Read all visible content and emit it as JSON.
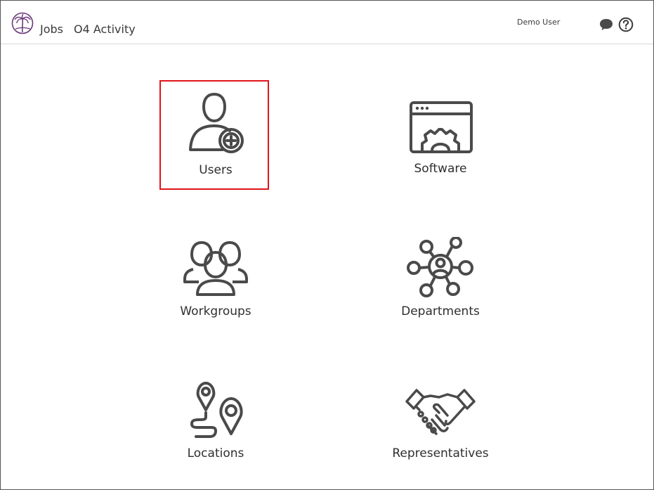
{
  "header": {
    "nav": {
      "jobs": "Jobs",
      "activity": "O4 Activity"
    },
    "user_name": "Demo User",
    "icons": [
      "palm-tree-logo",
      "chat-icon",
      "help-icon"
    ]
  },
  "tiles": [
    {
      "label": "Users",
      "icon": "user-add-icon",
      "selected": true
    },
    {
      "label": "Software",
      "icon": "software-gear-window-icon",
      "selected": false
    },
    {
      "label": "Workgroups",
      "icon": "group-people-icon",
      "selected": false
    },
    {
      "label": "Departments",
      "icon": "department-network-icon",
      "selected": false
    },
    {
      "label": "Locations",
      "icon": "map-pins-route-icon",
      "selected": false
    },
    {
      "label": "Representatives",
      "icon": "handshake-icon",
      "selected": false
    }
  ],
  "colors": {
    "selection_border": "#e0141a",
    "icon_stroke": "#4a4a4a",
    "logo": "#6b3a7a"
  }
}
